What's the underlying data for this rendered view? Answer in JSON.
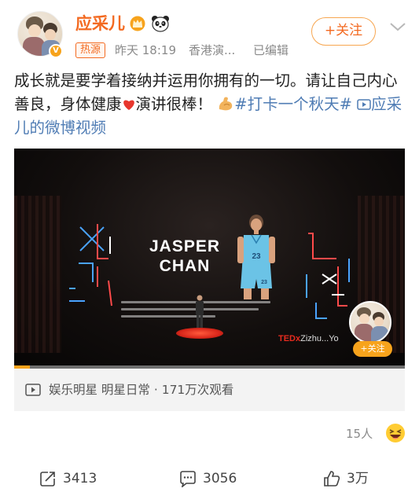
{
  "header": {
    "username": "应采儿",
    "hot_tag": "热源",
    "time": "昨天 18:19",
    "source": "香港演...",
    "edited": "已编辑",
    "follow_label": "+关注",
    "verified_badge": "V"
  },
  "post": {
    "text_part1": "成长就是要学着接纳并运用你拥有的一切。请让自己内心善良，身体健康",
    "text_part2": "演讲很棒！",
    "hashtag": "#打卡一个秋天#",
    "video_link": "应采儿的微博视频"
  },
  "video": {
    "speaker_name_line1": "JASPER",
    "speaker_name_line2": "CHAN",
    "jersey_number": "23",
    "event_logo_red": "TEDx",
    "event_logo_rest": "Zizhu...Yo",
    "progress": 0.04,
    "mini_follow_label": "+关注"
  },
  "video_info": {
    "text": "娱乐明星 明星日常 · 171万次观看"
  },
  "likes_summary": {
    "count": "15人"
  },
  "actions": {
    "repost": "3413",
    "comment": "3056",
    "like": "3万"
  },
  "colors": {
    "accent": "#f36a21",
    "link": "#4f7cb4",
    "gold": "#f7a31c"
  }
}
